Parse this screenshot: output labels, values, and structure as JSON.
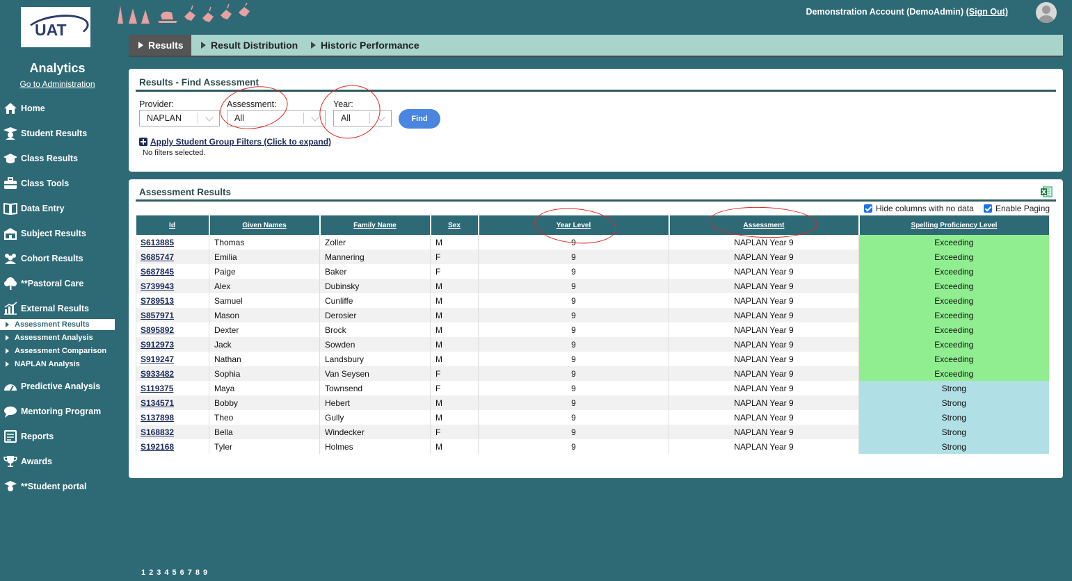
{
  "header": {
    "logo_text": "UAT",
    "app_title": "Analytics",
    "admin_link": "Go to Administration",
    "account": "Demonstration Account (DemoAdmin)",
    "signout": "(Sign Out)"
  },
  "sidebar": {
    "items": [
      {
        "label": "Home",
        "icon": "home-icon"
      },
      {
        "label": "Student Results",
        "icon": "graduate-icon"
      },
      {
        "label": "Class Results",
        "icon": "mortarboard-icon"
      },
      {
        "label": "Class Tools",
        "icon": "toolbox-icon"
      },
      {
        "label": "Data Entry",
        "icon": "book-icon"
      },
      {
        "label": "Subject Results",
        "icon": "building-icon"
      },
      {
        "label": "Cohort Results",
        "icon": "group-icon"
      },
      {
        "label": "**Pastoral Care",
        "icon": "tree-icon"
      },
      {
        "label": "External Results",
        "icon": "bar-chart-icon"
      }
    ],
    "sub_items": [
      {
        "label": "Assessment Results"
      },
      {
        "label": "Assessment Analysis"
      },
      {
        "label": "Assessment Comparison"
      },
      {
        "label": "NAPLAN Analysis"
      }
    ],
    "lower_items": [
      {
        "label": "Predictive Analysis",
        "icon": "gauge-icon"
      },
      {
        "label": "Mentoring Program",
        "icon": "chat-icon"
      },
      {
        "label": "Reports",
        "icon": "report-icon"
      },
      {
        "label": "Awards",
        "icon": "trophy-icon"
      },
      {
        "label": "**Student portal",
        "icon": "student-icon"
      }
    ]
  },
  "tabs": [
    {
      "label": "Results"
    },
    {
      "label": "Result Distribution"
    },
    {
      "label": "Historic Performance"
    }
  ],
  "find_panel": {
    "title": "Results - Find Assessment",
    "provider_label": "Provider:",
    "provider_value": "NAPLAN",
    "assessment_label": "Assessment:",
    "assessment_value": "All",
    "year_label": "Year:",
    "year_value": "All",
    "find_button": "Find",
    "filters_link": "Apply Student Group Filters (Click to expand)",
    "filters_status": "No filters selected."
  },
  "results_panel": {
    "title": "Assessment Results",
    "hide_columns_label": "Hide columns with no data",
    "enable_paging_label": "Enable Paging",
    "columns": [
      "Id",
      "Given Names",
      "Family Name",
      "Sex",
      "Year Level",
      "Assessment",
      "Spelling Proficiency Level"
    ],
    "rows": [
      [
        "S613885",
        "Thomas",
        "Zoller",
        "M",
        "9",
        "NAPLAN Year 9",
        "Exceeding"
      ],
      [
        "S685747",
        "Emilia",
        "Mannering",
        "F",
        "9",
        "NAPLAN Year 9",
        "Exceeding"
      ],
      [
        "S687845",
        "Paige",
        "Baker",
        "F",
        "9",
        "NAPLAN Year 9",
        "Exceeding"
      ],
      [
        "S739943",
        "Alex",
        "Dubinsky",
        "M",
        "9",
        "NAPLAN Year 9",
        "Exceeding"
      ],
      [
        "S789513",
        "Samuel",
        "Cunliffe",
        "M",
        "9",
        "NAPLAN Year 9",
        "Exceeding"
      ],
      [
        "S857971",
        "Mason",
        "Derosier",
        "M",
        "9",
        "NAPLAN Year 9",
        "Exceeding"
      ],
      [
        "S895892",
        "Dexter",
        "Brock",
        "M",
        "9",
        "NAPLAN Year 9",
        "Exceeding"
      ],
      [
        "S912973",
        "Jack",
        "Sowden",
        "M",
        "9",
        "NAPLAN Year 9",
        "Exceeding"
      ],
      [
        "S919247",
        "Nathan",
        "Landsbury",
        "M",
        "9",
        "NAPLAN Year 9",
        "Exceeding"
      ],
      [
        "S933482",
        "Sophia",
        "Van Seysen",
        "F",
        "9",
        "NAPLAN Year 9",
        "Exceeding"
      ],
      [
        "S119375",
        "Maya",
        "Townsend",
        "F",
        "9",
        "NAPLAN Year 9",
        "Strong"
      ],
      [
        "S134571",
        "Bobby",
        "Hebert",
        "M",
        "9",
        "NAPLAN Year 9",
        "Strong"
      ],
      [
        "S137898",
        "Theo",
        "Gully",
        "M",
        "9",
        "NAPLAN Year 9",
        "Strong"
      ],
      [
        "S168832",
        "Bella",
        "Windecker",
        "F",
        "9",
        "NAPLAN Year 9",
        "Strong"
      ],
      [
        "S192168",
        "Tyler",
        "Holmes",
        "M",
        "9",
        "NAPLAN Year 9",
        "Strong"
      ]
    ],
    "pages": [
      "1",
      "2",
      "3",
      "4",
      "5",
      "6",
      "7",
      "8",
      "9"
    ]
  },
  "colors": {
    "sidebar_bg": "#2e6a76",
    "exceeding": "#90ee90",
    "strong": "#b0e0e6",
    "annotation_red": "#e0261c",
    "find_button": "#4a86e0"
  }
}
